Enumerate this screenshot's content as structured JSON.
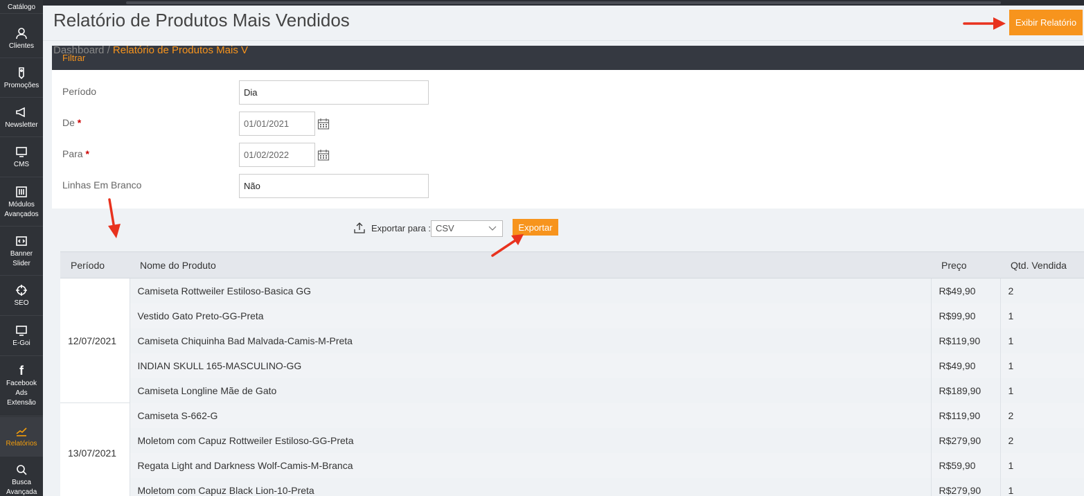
{
  "page": {
    "title": "Relatório de Produtos Mais Vendidos",
    "show_report_button": "Exibir Relatório",
    "breadcrumb_home": "Dashboard",
    "breadcrumb_sep": "/",
    "breadcrumb_current": "Relatório de Produtos Mais V"
  },
  "sidebar": {
    "items": [
      {
        "label": "Catálogo",
        "icon": "catalog-icon"
      },
      {
        "label": "Clientes",
        "icon": "user-icon"
      },
      {
        "label": "Promoções",
        "icon": "tag-icon"
      },
      {
        "label": "Newsletter",
        "icon": "megaphone-icon"
      },
      {
        "label": "CMS",
        "icon": "monitor-icon"
      },
      {
        "label": "Módulos Avançados",
        "icon": "sliders-icon"
      },
      {
        "label": "Banner Slider",
        "icon": "code-icon"
      },
      {
        "label": "SEO",
        "icon": "crosshair-icon"
      },
      {
        "label": "E-Goi",
        "icon": "monitor-icon"
      },
      {
        "label": "Facebook Ads Extensão",
        "icon": "facebook-icon"
      },
      {
        "label": "Relatórios",
        "icon": "chart-line-icon",
        "active": true
      },
      {
        "label": "Busca Avançada",
        "icon": "search-icon"
      }
    ]
  },
  "filter": {
    "header": "Filtrar",
    "periodo_label": "Período",
    "periodo_value": "Dia",
    "de_label": "De",
    "de_value": "01/01/2021",
    "para_label": "Para",
    "para_value": "01/02/2022",
    "linhas_label": "Linhas Em Branco",
    "linhas_value": "Não",
    "required_mark": "*"
  },
  "export": {
    "label": "Exportar para :",
    "format": "CSV",
    "button": "Exportar"
  },
  "table": {
    "headers": [
      "Período",
      "Nome do Produto",
      "Preço",
      "Qtd. Vendida"
    ],
    "groups": [
      {
        "period": "12/07/2021",
        "rows": [
          {
            "name": "Camiseta Rottweiler Estiloso-Basica GG",
            "price": "R$49,90",
            "qty": "2"
          },
          {
            "name": "Vestido Gato Preto-GG-Preta",
            "price": "R$99,90",
            "qty": "1"
          },
          {
            "name": "Camiseta Chiquinha Bad Malvada-Camis-M-Preta",
            "price": "R$119,90",
            "qty": "1"
          },
          {
            "name": "INDIAN SKULL 165-MASCULINO-GG",
            "price": "R$49,90",
            "qty": "1"
          },
          {
            "name": "Camiseta Longline Mãe de Gato",
            "price": "R$189,90",
            "qty": "1"
          }
        ]
      },
      {
        "period": "13/07/2021",
        "rows": [
          {
            "name": "Camiseta S-662-G",
            "price": "R$119,90",
            "qty": "2"
          },
          {
            "name": "Moletom com Capuz Rottweiler Estiloso-GG-Preta",
            "price": "R$279,90",
            "qty": "2"
          },
          {
            "name": "Regata Light and Darkness Wolf-Camis-M-Branca",
            "price": "R$59,90",
            "qty": "1"
          },
          {
            "name": "Moletom com Capuz Black Lion-10-Preta",
            "price": "R$279,90",
            "qty": "1"
          }
        ]
      }
    ]
  },
  "colors": {
    "accent": "#f7941d",
    "sidebar_bg": "#2f3237",
    "annotation_arrow": "#e8321e"
  }
}
